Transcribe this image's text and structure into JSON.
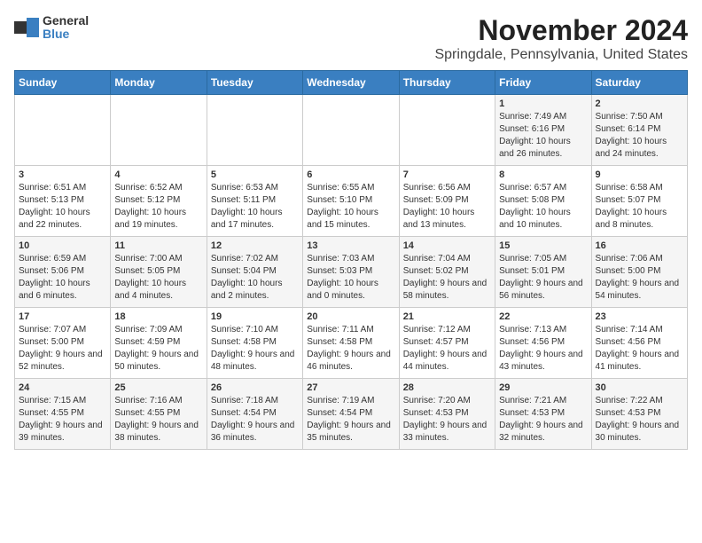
{
  "app": {
    "logo_general": "General",
    "logo_blue": "Blue"
  },
  "title": "November 2024",
  "subtitle": "Springdale, Pennsylvania, United States",
  "days_of_week": [
    "Sunday",
    "Monday",
    "Tuesday",
    "Wednesday",
    "Thursday",
    "Friday",
    "Saturday"
  ],
  "weeks": [
    [
      {
        "day": "",
        "info": ""
      },
      {
        "day": "",
        "info": ""
      },
      {
        "day": "",
        "info": ""
      },
      {
        "day": "",
        "info": ""
      },
      {
        "day": "",
        "info": ""
      },
      {
        "day": "1",
        "info": "Sunrise: 7:49 AM\nSunset: 6:16 PM\nDaylight: 10 hours and 26 minutes."
      },
      {
        "day": "2",
        "info": "Sunrise: 7:50 AM\nSunset: 6:14 PM\nDaylight: 10 hours and 24 minutes."
      }
    ],
    [
      {
        "day": "3",
        "info": "Sunrise: 6:51 AM\nSunset: 5:13 PM\nDaylight: 10 hours and 22 minutes."
      },
      {
        "day": "4",
        "info": "Sunrise: 6:52 AM\nSunset: 5:12 PM\nDaylight: 10 hours and 19 minutes."
      },
      {
        "day": "5",
        "info": "Sunrise: 6:53 AM\nSunset: 5:11 PM\nDaylight: 10 hours and 17 minutes."
      },
      {
        "day": "6",
        "info": "Sunrise: 6:55 AM\nSunset: 5:10 PM\nDaylight: 10 hours and 15 minutes."
      },
      {
        "day": "7",
        "info": "Sunrise: 6:56 AM\nSunset: 5:09 PM\nDaylight: 10 hours and 13 minutes."
      },
      {
        "day": "8",
        "info": "Sunrise: 6:57 AM\nSunset: 5:08 PM\nDaylight: 10 hours and 10 minutes."
      },
      {
        "day": "9",
        "info": "Sunrise: 6:58 AM\nSunset: 5:07 PM\nDaylight: 10 hours and 8 minutes."
      }
    ],
    [
      {
        "day": "10",
        "info": "Sunrise: 6:59 AM\nSunset: 5:06 PM\nDaylight: 10 hours and 6 minutes."
      },
      {
        "day": "11",
        "info": "Sunrise: 7:00 AM\nSunset: 5:05 PM\nDaylight: 10 hours and 4 minutes."
      },
      {
        "day": "12",
        "info": "Sunrise: 7:02 AM\nSunset: 5:04 PM\nDaylight: 10 hours and 2 minutes."
      },
      {
        "day": "13",
        "info": "Sunrise: 7:03 AM\nSunset: 5:03 PM\nDaylight: 10 hours and 0 minutes."
      },
      {
        "day": "14",
        "info": "Sunrise: 7:04 AM\nSunset: 5:02 PM\nDaylight: 9 hours and 58 minutes."
      },
      {
        "day": "15",
        "info": "Sunrise: 7:05 AM\nSunset: 5:01 PM\nDaylight: 9 hours and 56 minutes."
      },
      {
        "day": "16",
        "info": "Sunrise: 7:06 AM\nSunset: 5:00 PM\nDaylight: 9 hours and 54 minutes."
      }
    ],
    [
      {
        "day": "17",
        "info": "Sunrise: 7:07 AM\nSunset: 5:00 PM\nDaylight: 9 hours and 52 minutes."
      },
      {
        "day": "18",
        "info": "Sunrise: 7:09 AM\nSunset: 4:59 PM\nDaylight: 9 hours and 50 minutes."
      },
      {
        "day": "19",
        "info": "Sunrise: 7:10 AM\nSunset: 4:58 PM\nDaylight: 9 hours and 48 minutes."
      },
      {
        "day": "20",
        "info": "Sunrise: 7:11 AM\nSunset: 4:58 PM\nDaylight: 9 hours and 46 minutes."
      },
      {
        "day": "21",
        "info": "Sunrise: 7:12 AM\nSunset: 4:57 PM\nDaylight: 9 hours and 44 minutes."
      },
      {
        "day": "22",
        "info": "Sunrise: 7:13 AM\nSunset: 4:56 PM\nDaylight: 9 hours and 43 minutes."
      },
      {
        "day": "23",
        "info": "Sunrise: 7:14 AM\nSunset: 4:56 PM\nDaylight: 9 hours and 41 minutes."
      }
    ],
    [
      {
        "day": "24",
        "info": "Sunrise: 7:15 AM\nSunset: 4:55 PM\nDaylight: 9 hours and 39 minutes."
      },
      {
        "day": "25",
        "info": "Sunrise: 7:16 AM\nSunset: 4:55 PM\nDaylight: 9 hours and 38 minutes."
      },
      {
        "day": "26",
        "info": "Sunrise: 7:18 AM\nSunset: 4:54 PM\nDaylight: 9 hours and 36 minutes."
      },
      {
        "day": "27",
        "info": "Sunrise: 7:19 AM\nSunset: 4:54 PM\nDaylight: 9 hours and 35 minutes."
      },
      {
        "day": "28",
        "info": "Sunrise: 7:20 AM\nSunset: 4:53 PM\nDaylight: 9 hours and 33 minutes."
      },
      {
        "day": "29",
        "info": "Sunrise: 7:21 AM\nSunset: 4:53 PM\nDaylight: 9 hours and 32 minutes."
      },
      {
        "day": "30",
        "info": "Sunrise: 7:22 AM\nSunset: 4:53 PM\nDaylight: 9 hours and 30 minutes."
      }
    ]
  ]
}
